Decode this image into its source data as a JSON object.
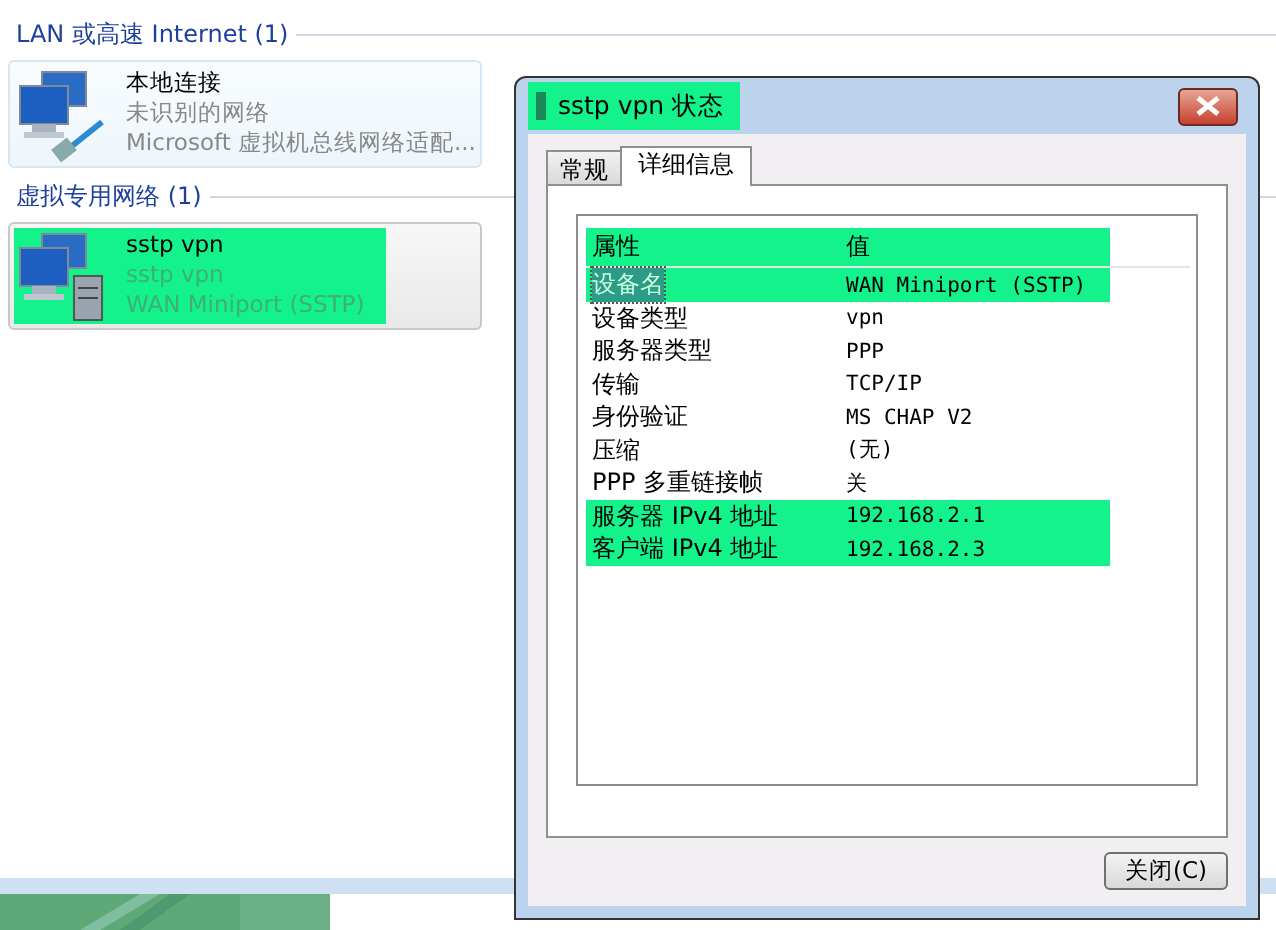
{
  "groups": [
    {
      "title": "LAN 或高速 Internet (1)",
      "items": [
        {
          "name": "本地连接",
          "status": "未识别的网络",
          "device": "Microsoft 虚拟机总线网络适配...",
          "highlighted": false
        }
      ]
    },
    {
      "title": "虚拟专用网络 (1)",
      "items": [
        {
          "name": "sstp vpn",
          "status": "sstp vpn",
          "device": "WAN Miniport (SSTP)",
          "highlighted": true
        }
      ]
    }
  ],
  "dialog": {
    "title": "sstp vpn 状态",
    "title_highlighted": true,
    "tabs": [
      {
        "label": "常规",
        "selected": false
      },
      {
        "label": "详细信息",
        "selected": true
      }
    ],
    "columns": [
      "属性",
      "值"
    ],
    "header_highlighted": true,
    "rows": [
      {
        "property": "设备名",
        "value": "WAN Miniport (SSTP)",
        "selected": true,
        "highlighted": true
      },
      {
        "property": "设备类型",
        "value": "vpn",
        "selected": false,
        "highlighted": false
      },
      {
        "property": "服务器类型",
        "value": "PPP",
        "selected": false,
        "highlighted": false
      },
      {
        "property": "传输",
        "value": "TCP/IP",
        "selected": false,
        "highlighted": false
      },
      {
        "property": "身份验证",
        "value": "MS CHAP V2",
        "selected": false,
        "highlighted": false
      },
      {
        "property": "压缩",
        "value": "(无)",
        "selected": false,
        "highlighted": false
      },
      {
        "property": "PPP 多重链接帧",
        "value": "关",
        "selected": false,
        "highlighted": false
      },
      {
        "property": "服务器 IPv4 地址",
        "value": "192.168.2.1",
        "selected": false,
        "highlighted": true
      },
      {
        "property": "客户端 IPv4 地址",
        "value": "192.168.2.3",
        "selected": false,
        "highlighted": true
      }
    ],
    "button": "关闭(C)"
  }
}
